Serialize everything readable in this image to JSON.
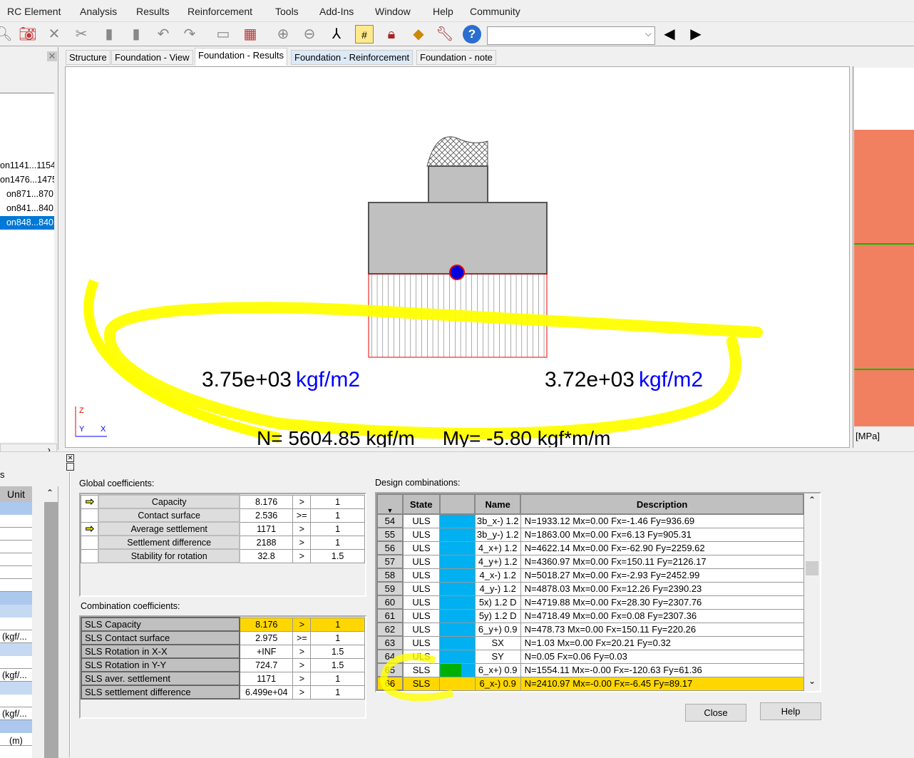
{
  "menu": [
    "RC Element",
    "Analysis",
    "Results",
    "Reinforcement",
    "Tools",
    "Add-Ins",
    "Window",
    "Help",
    "Community"
  ],
  "toolbar": {
    "icons": [
      "zoom-icon",
      "camera-icon",
      "delete-icon",
      "cut-icon",
      "copy-icon",
      "paste-icon",
      "undo-icon",
      "redo-icon",
      "screen-icon",
      "calculator-icon",
      "zoom-in-icon",
      "zoom-out-icon",
      "refresh-axes-icon",
      "table-icon",
      "lock-icon",
      "model-icon",
      "wrench-icon",
      "help-icon"
    ],
    "combo_value": ""
  },
  "tabs": [
    "Structure",
    "Foundation - View",
    "Foundation - Results",
    "Foundation - Reinforcement",
    "Foundation - note"
  ],
  "tree": {
    "items": [
      "on1141...1154",
      "on1476...1475",
      "on871...870",
      "on841...840",
      "on848...840"
    ],
    "selected": 4
  },
  "drawing": {
    "left_pressure": "3.75e+03",
    "right_pressure": "3.72e+03",
    "pressure_unit": "kgf/m2",
    "forces": "N= 5604.85 kgf/m     My= -5.80 kgf*m/m",
    "axis_z": "Z",
    "axis_y": "Y",
    "axis_x": "X"
  },
  "legend": {
    "unit": "[MPa]",
    "color": "#f08060"
  },
  "left_bottom": {
    "tab_fragment": "s",
    "unit_header": "Unit",
    "units": [
      "(kgf/...",
      "(kgf/...",
      "(kgf/...",
      "(m)"
    ]
  },
  "global": {
    "title": "Global coefficients:",
    "rows": [
      {
        "arrow": true,
        "name": "Capacity",
        "value": "8.176",
        "op": ">",
        "limit": "1"
      },
      {
        "arrow": false,
        "name": "Contact surface",
        "value": "2.536",
        "op": ">=",
        "limit": "1"
      },
      {
        "arrow": true,
        "name": "Average settlement",
        "value": "1171",
        "op": ">",
        "limit": "1"
      },
      {
        "arrow": false,
        "name": "Settlement difference",
        "value": "2188",
        "op": ">",
        "limit": "1"
      },
      {
        "arrow": false,
        "name": "Stability for rotation",
        "value": "32.8",
        "op": ">",
        "limit": "1.5"
      }
    ]
  },
  "combination": {
    "title": "Combination coefficients:",
    "rows": [
      {
        "name": "SLS Capacity",
        "value": "8.176",
        "op": ">",
        "limit": "1"
      },
      {
        "name": "SLS Contact surface",
        "value": "2.975",
        "op": ">=",
        "limit": "1"
      },
      {
        "name": "SLS Rotation in X-X",
        "value": "+INF",
        "op": ">",
        "limit": "1.5"
      },
      {
        "name": "SLS Rotation in Y-Y",
        "value": "724.7",
        "op": ">",
        "limit": "1.5"
      },
      {
        "name": "SLS aver. settlement",
        "value": "1171",
        "op": ">",
        "limit": "1"
      },
      {
        "name": "SLS settlement difference",
        "value": "6.499e+04",
        "op": ">",
        "limit": "1"
      }
    ]
  },
  "design": {
    "title": "Design combinations:",
    "headers": {
      "state": "State",
      "name": "Name",
      "description": "Description"
    },
    "rows": [
      {
        "n": "54",
        "state": "ULS",
        "name": "3b_x-) 1.2",
        "desc": "N=1933.12 Mx=0.00 Fx=-1.46 Fy=936.69"
      },
      {
        "n": "55",
        "state": "ULS",
        "name": "3b_y-) 1.2",
        "desc": "N=1863.00 Mx=0.00 Fx=6.13 Fy=905.31"
      },
      {
        "n": "56",
        "state": "ULS",
        "name": "4_x+) 1.2",
        "desc": "N=4622.14 Mx=0.00 Fx=-62.90 Fy=2259.62"
      },
      {
        "n": "57",
        "state": "ULS",
        "name": "4_y+) 1.2",
        "desc": "N=4360.97 Mx=0.00 Fx=150.11 Fy=2126.17"
      },
      {
        "n": "58",
        "state": "ULS",
        "name": "4_x-) 1.2",
        "desc": "N=5018.27 Mx=0.00 Fx=-2.93 Fy=2452.99"
      },
      {
        "n": "59",
        "state": "ULS",
        "name": "4_y-) 1.2",
        "desc": "N=4878.03 Mx=0.00 Fx=12.26 Fy=2390.23"
      },
      {
        "n": "60",
        "state": "ULS",
        "name": "5x) 1.2 D",
        "desc": "N=4719.88 Mx=0.00 Fx=28.30 Fy=2307.76"
      },
      {
        "n": "61",
        "state": "ULS",
        "name": "5y) 1.2 D",
        "desc": "N=4718.49 Mx=0.00 Fx=0.08 Fy=2307.36"
      },
      {
        "n": "62",
        "state": "ULS",
        "name": "6_y+) 0.9",
        "desc": "N=478.73 Mx=0.00 Fx=150.11 Fy=220.26"
      },
      {
        "n": "63",
        "state": "ULS",
        "name": "SX",
        "desc": "N=1.03 Mx=0.00 Fx=20.21 Fy=0.32"
      },
      {
        "n": "64",
        "state": "ULS",
        "name": "SY",
        "desc": "N=0.05 Fx=0.06 Fy=0.03"
      },
      {
        "n": "65",
        "state": "SLS",
        "name": "6_x+) 0.9",
        "desc": "N=1554.11 Mx=-0.00 Fx=-120.63 Fy=61.36"
      },
      {
        "n": "66",
        "state": "SLS",
        "name": "6_x-) 0.9",
        "desc": "N=2410.97 Mx=-0.00 Fx=-6.45 Fy=89.17"
      }
    ],
    "selected": "66"
  },
  "buttons": {
    "close": "Close",
    "help": "Help"
  }
}
